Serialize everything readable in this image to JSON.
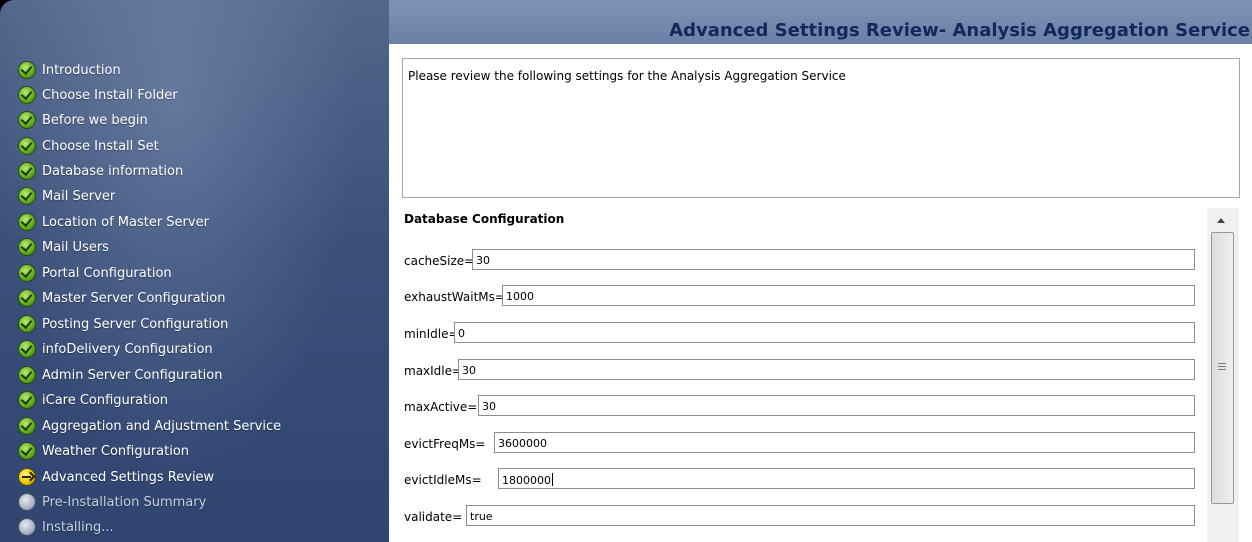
{
  "header": {
    "title": "Advanced Settings Review- Analysis Aggregation Service"
  },
  "sidebar": {
    "steps": [
      {
        "label": "Introduction",
        "status": "done"
      },
      {
        "label": "Choose Install Folder",
        "status": "done"
      },
      {
        "label": "Before we begin",
        "status": "done"
      },
      {
        "label": "Choose Install Set",
        "status": "done"
      },
      {
        "label": "Database information",
        "status": "done"
      },
      {
        "label": "Mail Server",
        "status": "done"
      },
      {
        "label": "Location of Master Server",
        "status": "done"
      },
      {
        "label": "Mail Users",
        "status": "done"
      },
      {
        "label": "Portal Configuration",
        "status": "done"
      },
      {
        "label": "Master Server Configuration",
        "status": "done"
      },
      {
        "label": "Posting Server Configuration",
        "status": "done"
      },
      {
        "label": "infoDelivery Configuration",
        "status": "done"
      },
      {
        "label": "Admin Server Configuration",
        "status": "done"
      },
      {
        "label": "iCare Configuration",
        "status": "done"
      },
      {
        "label": "Aggregation and Adjustment Service",
        "status": "done"
      },
      {
        "label": "Weather Configuration",
        "status": "done"
      },
      {
        "label": "Advanced Settings Review",
        "status": "current"
      },
      {
        "label": "Pre-Installation Summary",
        "status": "pending"
      },
      {
        "label": "Installing...",
        "status": "pending"
      }
    ]
  },
  "main": {
    "intro_text": "Please review the following settings for the Analysis Aggregation Service",
    "section_title": "Database Configuration",
    "fields": [
      {
        "label": "cacheSize=",
        "value": "30"
      },
      {
        "label": "exhaustWaitMs=",
        "value": "1000"
      },
      {
        "label": "minIdle=",
        "value": "0"
      },
      {
        "label": "maxIdle=",
        "value": "30"
      },
      {
        "label": "maxActive=",
        "value": "30"
      },
      {
        "label": "evictFreqMs=",
        "value": "3600000"
      },
      {
        "label": "evictIdleMs=",
        "value": "1800000"
      },
      {
        "label": "validate=",
        "value": "true"
      }
    ]
  },
  "icons": {
    "done": "check-circle-icon",
    "current": "arrow-right-circle-icon",
    "pending": "grey-circle-icon"
  },
  "colors": {
    "header_title": "#12285a",
    "done_icon": "#5eaa1c",
    "current_icon": "#e6c400"
  }
}
